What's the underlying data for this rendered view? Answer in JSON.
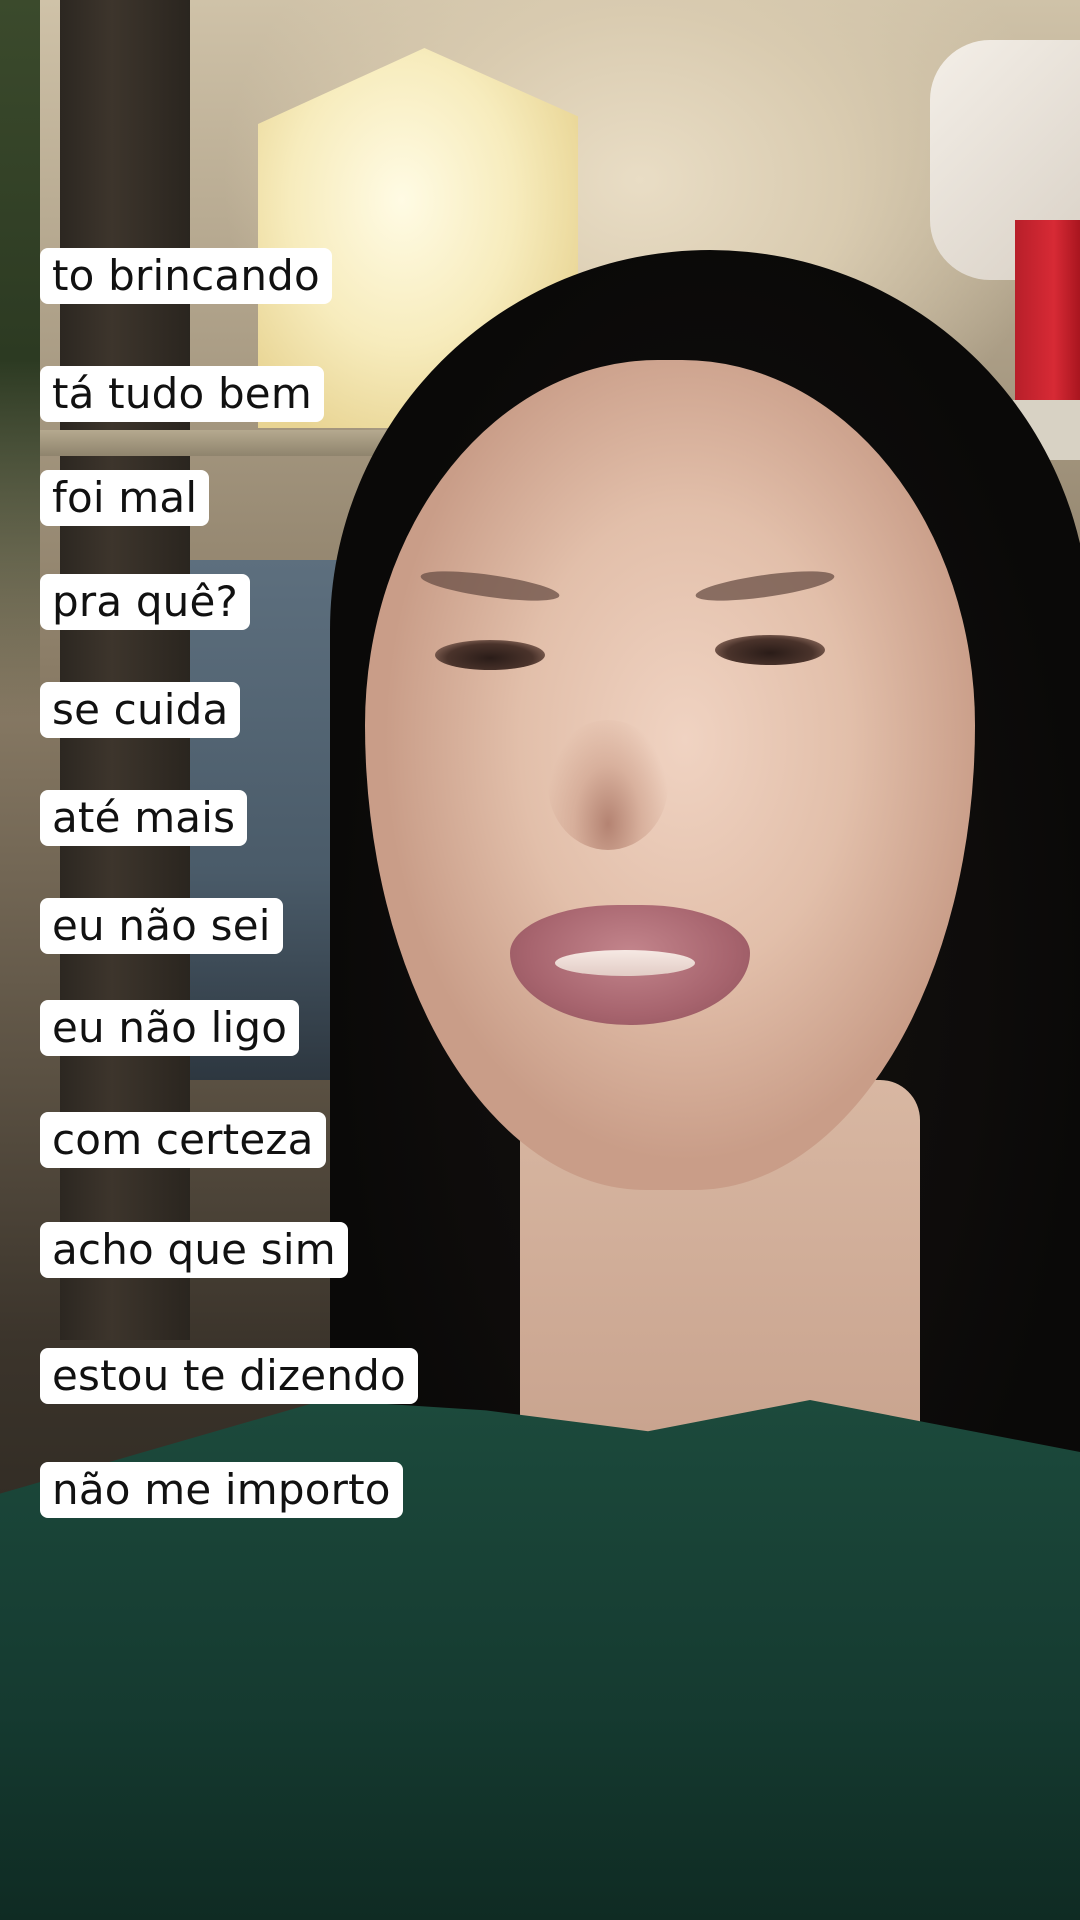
{
  "captions": [
    "to brincando",
    "tá tudo bem",
    "foi mal",
    "pra quê?",
    "se cuida",
    "até mais",
    "eu não sei",
    "eu não ligo",
    "com certeza",
    "acho que sim",
    "estou te dizendo",
    "não me importo"
  ],
  "colors": {
    "caption_background": "#ffffff",
    "caption_text": "#111111"
  }
}
